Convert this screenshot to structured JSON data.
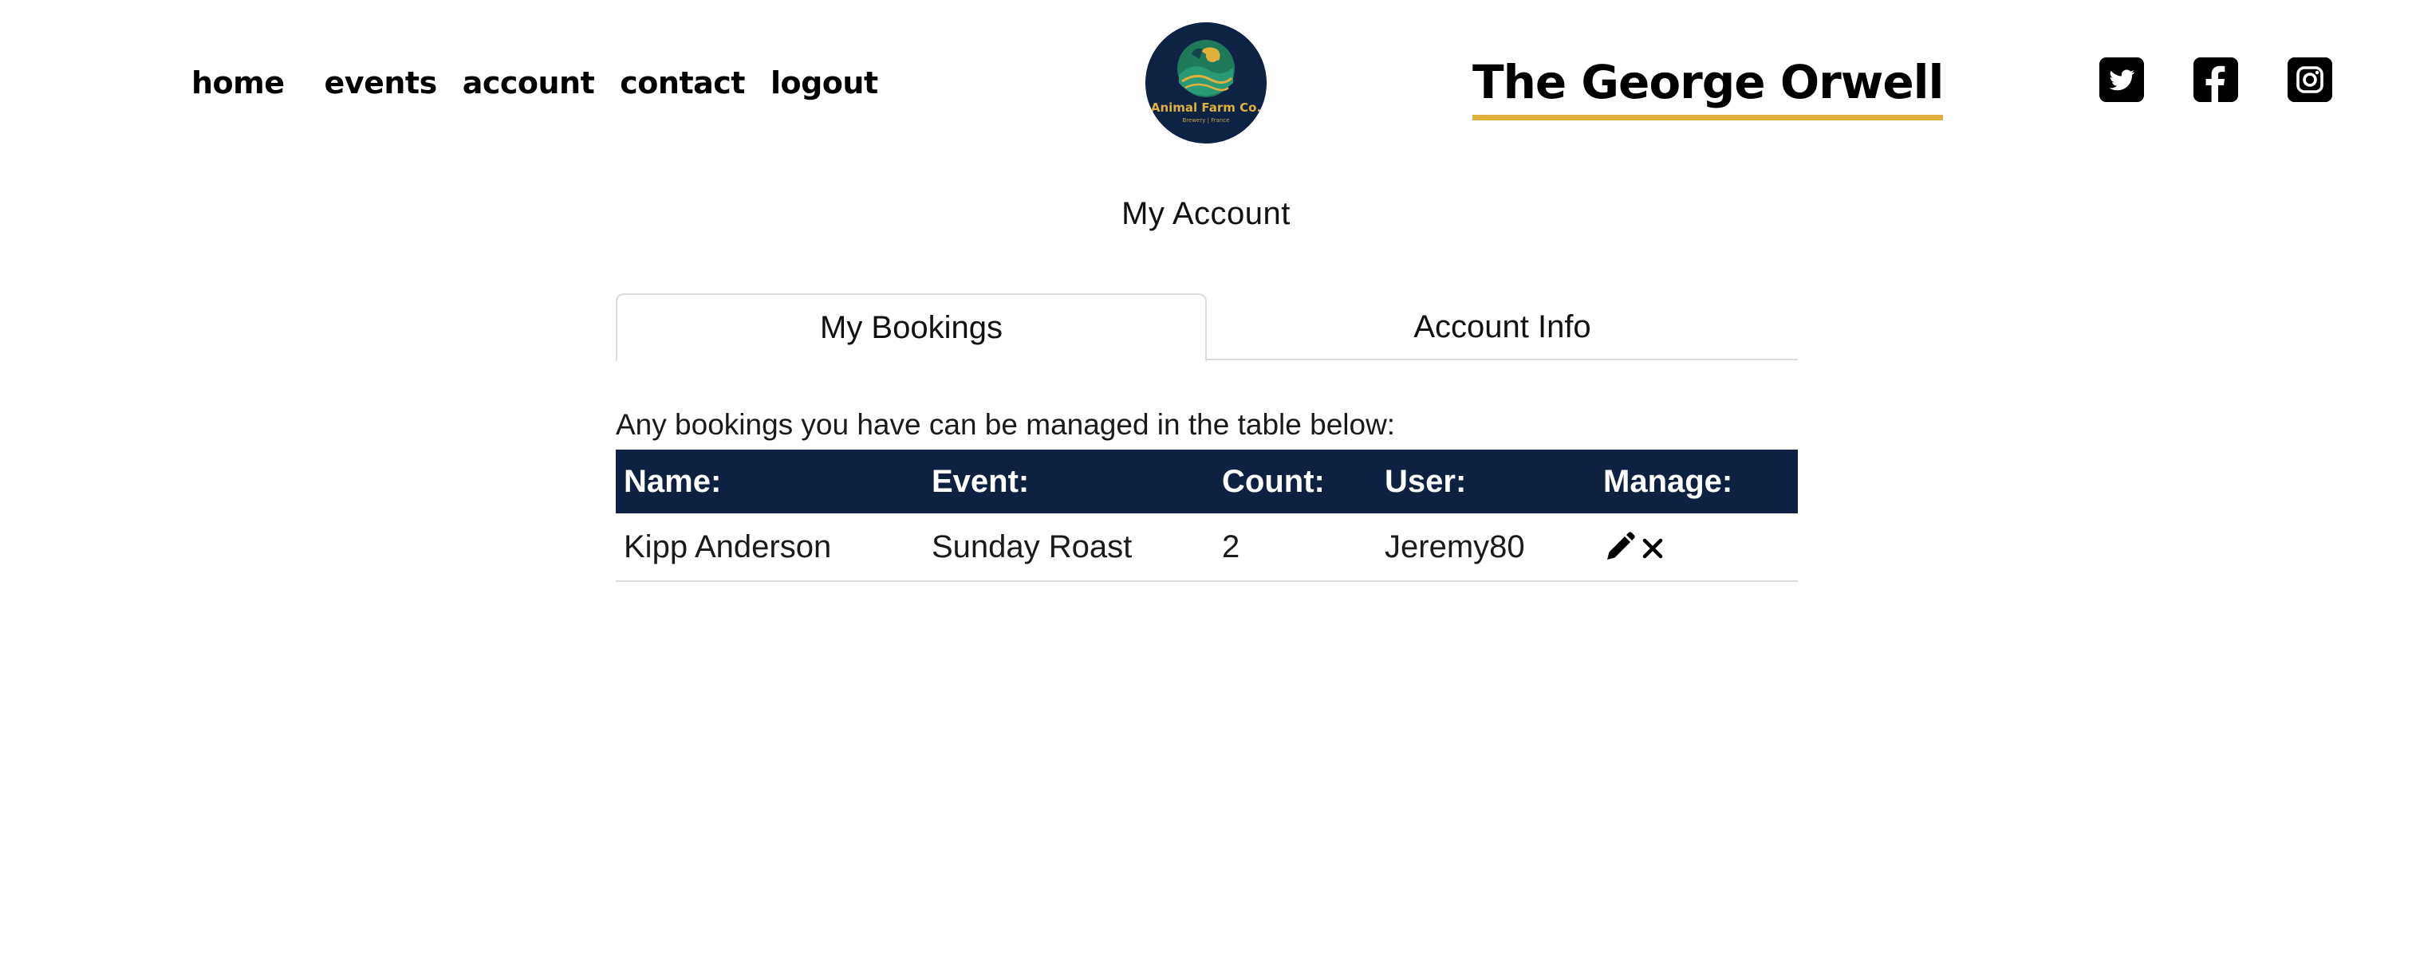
{
  "nav": {
    "items": [
      {
        "label": "home"
      },
      {
        "label": "events"
      },
      {
        "label": "account"
      },
      {
        "label": "contact"
      },
      {
        "label": "logout"
      }
    ]
  },
  "logo": {
    "name": "Animal Farm Co.",
    "tagline": "Brewery | France",
    "colors": {
      "background": "#0e2244",
      "accent": "#e0b03c",
      "green": "#1f7a5a"
    }
  },
  "site": {
    "title": "The George Orwell",
    "underline_color": "#e0b03c"
  },
  "social": [
    {
      "icon": "twitter-icon"
    },
    {
      "icon": "facebook-icon"
    },
    {
      "icon": "instagram-icon"
    }
  ],
  "page": {
    "heading": "My Account"
  },
  "tabs": [
    {
      "label": "My Bookings",
      "active": true
    },
    {
      "label": "Account Info",
      "active": false
    }
  ],
  "bookings": {
    "intro": "Any bookings you have can be managed in the table below:",
    "header_color": "#0f2142",
    "columns": [
      "Name:",
      "Event:",
      "Count:",
      "User:",
      "Manage:"
    ],
    "rows": [
      {
        "name": "Kipp Anderson",
        "event": "Sunday Roast",
        "count": "2",
        "user": "Jeremy80",
        "actions": [
          "pencil-icon",
          "close-icon"
        ]
      }
    ]
  }
}
